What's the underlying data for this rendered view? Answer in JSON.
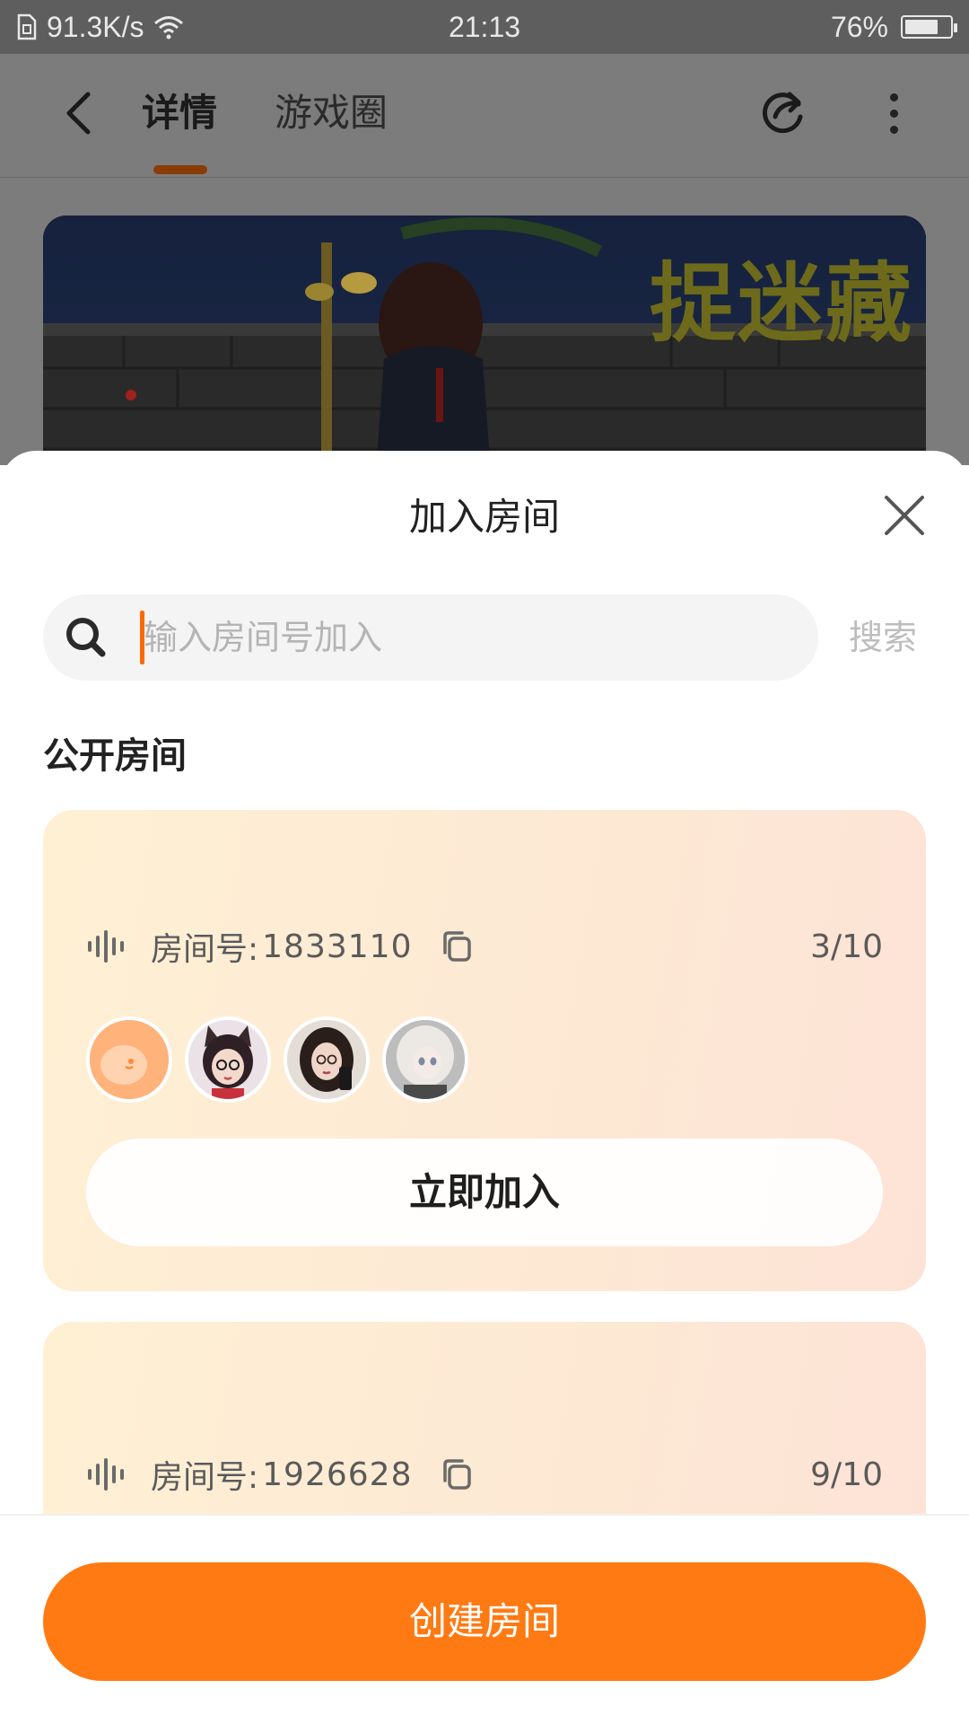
{
  "status_bar": {
    "network_speed": "91.3K/s",
    "time": "21:13",
    "battery_percent": "76%",
    "battery_level": 0.76
  },
  "header": {
    "tabs": [
      {
        "label": "详情",
        "active": true
      },
      {
        "label": "游戏圈",
        "active": false
      }
    ],
    "accent_color": "#8a3c07"
  },
  "banner": {
    "title": "捉迷藏"
  },
  "sheet": {
    "title": "加入房间",
    "search": {
      "placeholder": "输入房间号加入",
      "value": "",
      "button_label": "搜索"
    },
    "section_title": "公开房间",
    "rooms": [
      {
        "label": "房间号:",
        "number": "1833110",
        "occupancy": "3/10",
        "join_label": "立即加入",
        "avatars": [
          "app-mascot-avatar",
          "cat-ear-girl-avatar",
          "selfie-girl-avatar",
          "doll-avatar"
        ]
      },
      {
        "label": "房间号:",
        "number": "1926628",
        "occupancy": "9/10"
      }
    ],
    "create_button_label": "创建房间",
    "primary_color": "#ff7a13"
  }
}
